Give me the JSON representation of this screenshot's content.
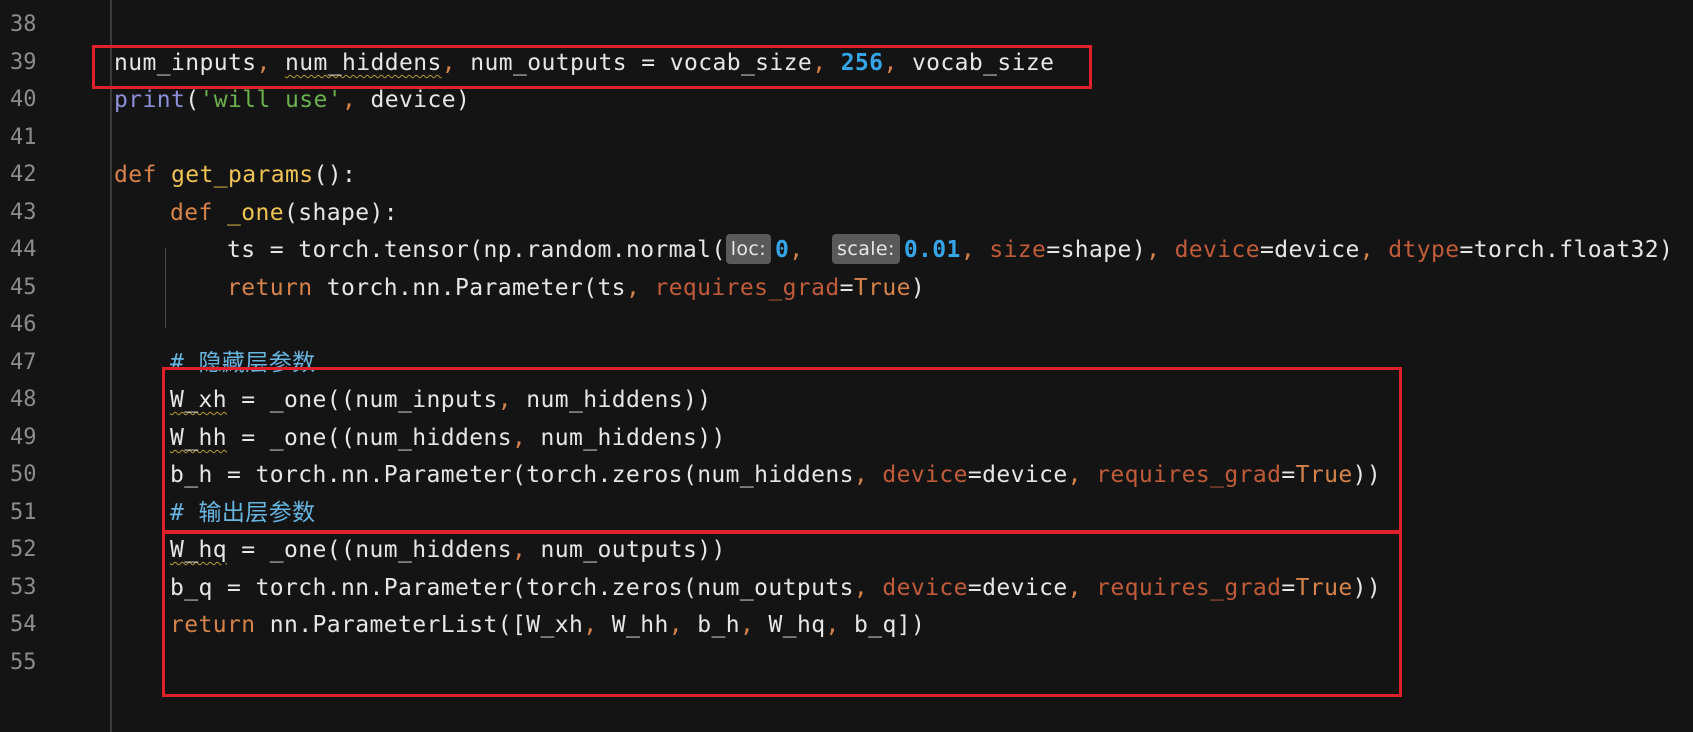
{
  "editor": {
    "line_numbers": [
      "38",
      "39",
      "40",
      "41",
      "42",
      "43",
      "44",
      "45",
      "46",
      "47",
      "48",
      "49",
      "50",
      "51",
      "52",
      "53",
      "54",
      "55"
    ],
    "tokens": {
      "num_inputs": "num_inputs",
      "num_hiddens": "num_hiddens",
      "num_outputs": "num_outputs",
      "vocab_size": "vocab_size",
      "n256": "256",
      "print": "print",
      "str_will_use": "'will use'",
      "device": "device",
      "def": "def",
      "get_params": "get_params",
      "one_fn": "_one",
      "shape": "shape",
      "ts": "ts",
      "torch_tensor": "torch.tensor",
      "np_random_normal": "np.random.normal",
      "hint_loc": "loc:",
      "zero": "0",
      "hint_scale": "scale:",
      "n001": "0.01",
      "size": "size",
      "dtype": "dtype",
      "torch_float32": "torch.float32",
      "return": "return",
      "torch_nn_Parameter": "torch.nn.Parameter",
      "requires_grad": "requires_grad",
      "true": "True",
      "comment_hidden": "# 隐藏层参数",
      "W_xh": "W_xh",
      "W_hh": "W_hh",
      "b_h": "b_h",
      "torch_zeros": "torch.zeros",
      "comment_output": "# 输出层参数",
      "W_hq": "W_hq",
      "b_q": "b_q",
      "nn_ParameterList": "nn.ParameterList"
    }
  },
  "colors": {
    "background": "#141414",
    "keyword": "#d5834a",
    "function": "#f0c454",
    "builtin": "#8a8fd8",
    "string": "#6ab04c",
    "number": "#35a5e8",
    "param": "#c05b3a",
    "comment": "#67b5e0",
    "highlight_box": "#e0212b"
  }
}
